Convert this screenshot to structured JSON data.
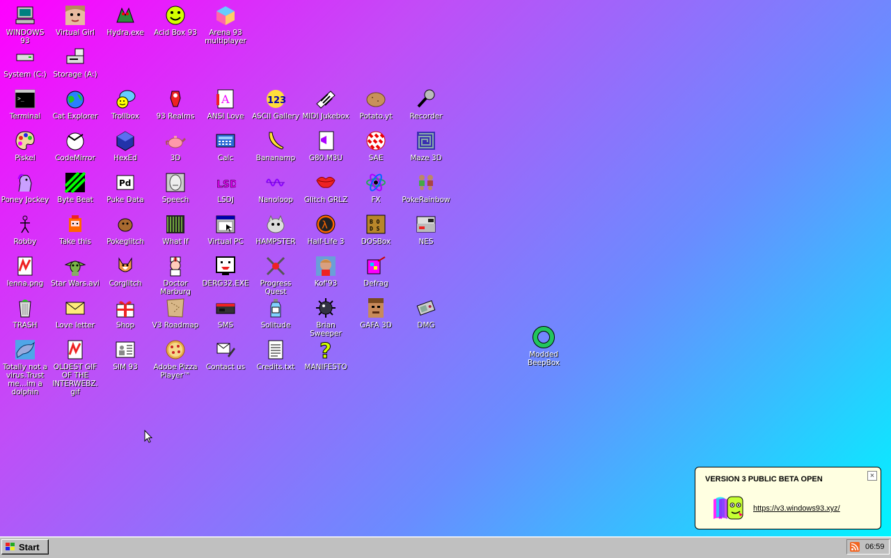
{
  "desktop": {
    "icons": [
      {
        "label": "WINDOWS 93",
        "icon": "computer-icon"
      },
      {
        "label": "Virtual Girl",
        "icon": "face-icon"
      },
      {
        "label": "Hydra.exe",
        "icon": "hydra-icon"
      },
      {
        "label": "Acid Box 93",
        "icon": "smiley-icon"
      },
      {
        "label": "Arena 93 multiplayer",
        "icon": "cube-icon"
      },
      {
        "label": "System (C:)",
        "icon": "drive-icon"
      },
      {
        "label": "Storage (A:)",
        "icon": "floppy-drive-icon"
      },
      {
        "label": "Terminal",
        "icon": "terminal-icon"
      },
      {
        "label": "Cat Explorer",
        "icon": "globe-cat-icon"
      },
      {
        "label": "Trollbox",
        "icon": "chat-icon"
      },
      {
        "label": "93 Realms",
        "icon": "realms-icon"
      },
      {
        "label": "ANSI Love",
        "icon": "ansi-icon"
      },
      {
        "label": "ASCII Gallery",
        "icon": "ascii-icon"
      },
      {
        "label": "MIDI Jukebox",
        "icon": "piano-icon"
      },
      {
        "label": "Potato.yt",
        "icon": "potato-icon"
      },
      {
        "label": "Recorder",
        "icon": "microphone-icon"
      },
      {
        "label": "Piskel",
        "icon": "palette-icon"
      },
      {
        "label": "CodeMirror",
        "icon": "codemirror-icon"
      },
      {
        "label": "HexEd",
        "icon": "hex-icon"
      },
      {
        "label": "3D",
        "icon": "teapot-icon"
      },
      {
        "label": "Calc",
        "icon": "calculator-icon"
      },
      {
        "label": "Bananamp",
        "icon": "banana-icon"
      },
      {
        "label": "G80.M3U",
        "icon": "playlist-icon"
      },
      {
        "label": "SAE",
        "icon": "ball-icon"
      },
      {
        "label": "Maze 3D",
        "icon": "maze-icon"
      },
      {
        "label": "Poney Jockey",
        "icon": "pony-icon"
      },
      {
        "label": "Byte Beat",
        "icon": "bytebeat-icon"
      },
      {
        "label": "Puke Data",
        "icon": "pd-icon"
      },
      {
        "label": "Speech",
        "icon": "speech-icon"
      },
      {
        "label": "LSDJ",
        "icon": "lsdj-icon"
      },
      {
        "label": "Nanoloop",
        "icon": "wave-icon"
      },
      {
        "label": "Glitch GRLZ",
        "icon": "lips-icon"
      },
      {
        "label": "FX",
        "icon": "atom-icon"
      },
      {
        "label": "PokeRainbow",
        "icon": "people-icon"
      },
      {
        "label": "Robby",
        "icon": "stickman-icon"
      },
      {
        "label": "Take this",
        "icon": "fox-icon"
      },
      {
        "label": "Pokeglitch",
        "icon": "pokeglitch-icon"
      },
      {
        "label": "What If",
        "icon": "whatif-icon"
      },
      {
        "label": "Virtual PC",
        "icon": "window-icon"
      },
      {
        "label": "HAMPSTER",
        "icon": "hamster-icon"
      },
      {
        "label": "Half-Life 3",
        "icon": "lambda-icon"
      },
      {
        "label": "DOSBox",
        "icon": "dosbox-icon"
      },
      {
        "label": "NES",
        "icon": "nes-icon"
      },
      {
        "label": "lenna.png",
        "icon": "image-file-icon"
      },
      {
        "label": "Star Wars.avi",
        "icon": "yoda-icon"
      },
      {
        "label": "Corglitch",
        "icon": "corgi-icon"
      },
      {
        "label": "Doctor Marburg",
        "icon": "doctor-icon"
      },
      {
        "label": "DERG32.EXE",
        "icon": "monitor-face-icon"
      },
      {
        "label": "Progress Quest",
        "icon": "swords-icon"
      },
      {
        "label": "Kof'93",
        "icon": "fighter-icon"
      },
      {
        "label": "Defrag",
        "icon": "defrag-icon"
      },
      {
        "label": "TRASH",
        "icon": "trash-icon"
      },
      {
        "label": "Love letter",
        "icon": "envelope-icon"
      },
      {
        "label": "Shop",
        "icon": "gift-icon"
      },
      {
        "label": "V3 Roadmap",
        "icon": "map-icon"
      },
      {
        "label": "SMS",
        "icon": "console-icon"
      },
      {
        "label": "Solitude",
        "icon": "bottle-icon"
      },
      {
        "label": "Brian Sweeper",
        "icon": "mine-icon"
      },
      {
        "label": "GAFA 3D",
        "icon": "doom-face-icon"
      },
      {
        "label": "DMG",
        "icon": "gameboy-icon"
      },
      {
        "label": "Totally not a virus.Trust me...im a dolphin",
        "icon": "dolphin-icon"
      },
      {
        "label": "OLDEST GIF OF THE INTERWEBZ.gif",
        "icon": "gif-file-icon"
      },
      {
        "label": "SIM 93",
        "icon": "sim-icon"
      },
      {
        "label": "Adobe Pizza Player™",
        "icon": "pizza-icon"
      },
      {
        "label": "Contact us",
        "icon": "contact-icon"
      },
      {
        "label": "Credits.txt",
        "icon": "text-file-icon"
      },
      {
        "label": "MANIFESTO",
        "icon": "question-icon"
      }
    ],
    "beepbox": {
      "label": "Modded BeepBox",
      "icon": "ring-icon"
    }
  },
  "taskbar": {
    "start_label": "Start",
    "clock": "06:59",
    "tray_icon": "rss-icon"
  },
  "notification": {
    "title": "VERSION 3 PUBLIC BETA OPEN",
    "link": "https://v3.windows93.xyz/",
    "close": "×"
  },
  "colors": {
    "gradient_start": "#ff00ff",
    "gradient_end": "#00f4ff",
    "taskbar": "#c0c0c0",
    "balloon": "#ffffe1"
  }
}
